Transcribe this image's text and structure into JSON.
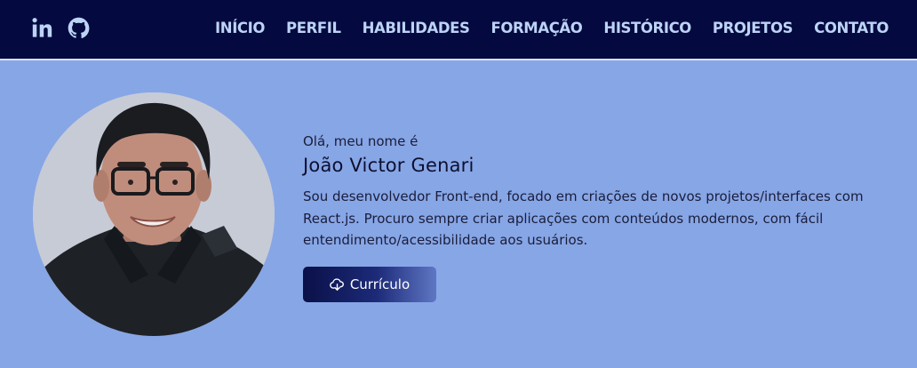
{
  "nav": {
    "social": [
      {
        "name": "linkedin-icon"
      },
      {
        "name": "github-icon"
      }
    ],
    "links": [
      "INÍCIO",
      "PERFIL",
      "HABILIDADES",
      "FORMAÇÃO",
      "HISTÓRICO",
      "PROJETOS",
      "CONTATO"
    ],
    "colors": {
      "background": "#04093f",
      "link": "#bcd3f5"
    }
  },
  "hero": {
    "greeting": "Olá, meu nome é",
    "name": "João Victor Genari",
    "description": "Sou desenvolvedor Front-end, focado em criações de novos projetos/interfaces com React.js. Procuro sempre criar aplicações com conteúdos modernos, com fácil entendimento/acessibilidade aos usuários.",
    "button_label": "Currículo",
    "button_icon": "cloud-download-icon",
    "colors": {
      "background": "#87a6e6",
      "button": "#0a1048"
    }
  }
}
